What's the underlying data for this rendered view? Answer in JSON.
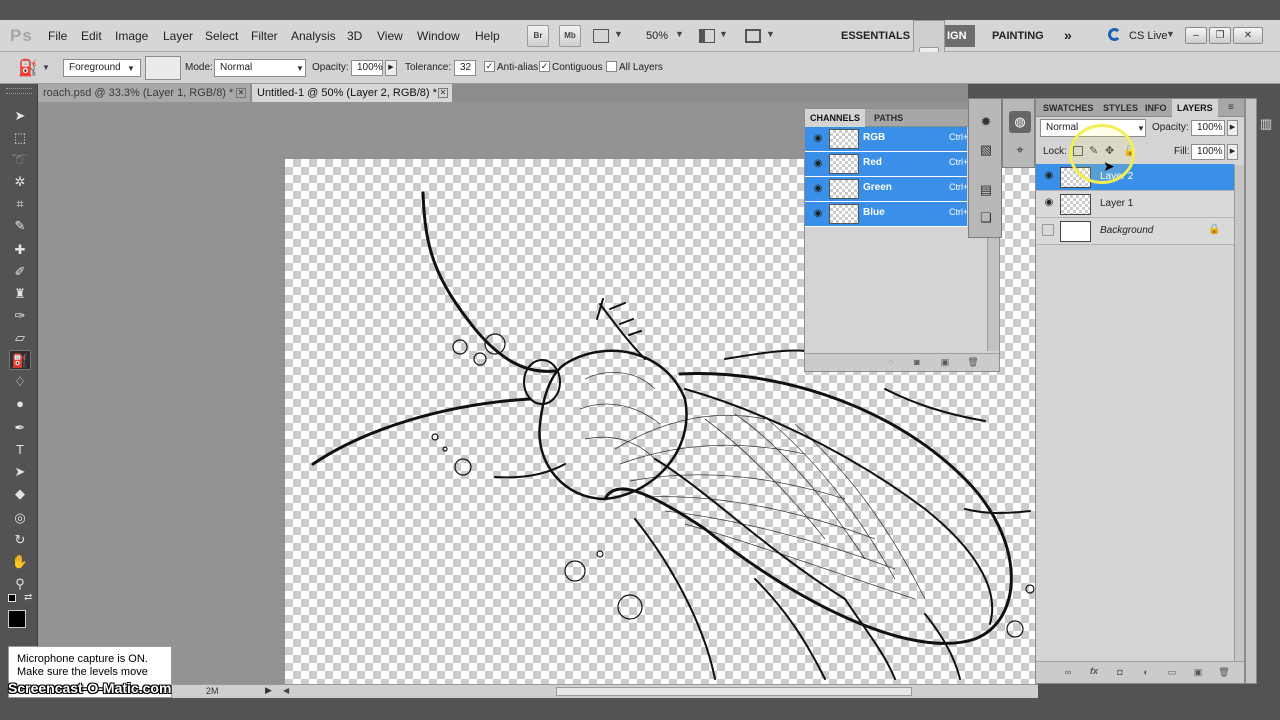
{
  "app": {
    "logo": "Ps"
  },
  "menu": [
    "File",
    "Edit",
    "Image",
    "Layer",
    "Select",
    "Filter",
    "Analysis",
    "3D",
    "View",
    "Window",
    "Help"
  ],
  "app_bar": {
    "bridge": "Br",
    "mini_bridge": "Mb",
    "zoom": "50%"
  },
  "workspaces": {
    "essentials": "ESSENTIALS",
    "design": "IGN",
    "painting": "PAINTING",
    "more": "»",
    "cslive": "CS Live"
  },
  "options": {
    "fill_source": "Foreground",
    "mode_label": "Mode:",
    "mode_value": "Normal",
    "opacity_label": "Opacity:",
    "opacity_value": "100%",
    "tolerance_label": "Tolerance:",
    "tolerance_value": "32",
    "anti_alias": "Anti-alias",
    "contiguous": "Contiguous",
    "all_layers": "All Layers"
  },
  "tabs": [
    {
      "label": "roach.psd @ 33.3% (Layer 1, RGB/8) *"
    },
    {
      "label": "Untitled-1 @ 50% (Layer 2, RGB/8) *"
    }
  ],
  "channels_panel": {
    "tabs": [
      "CHANNELS",
      "PATHS"
    ],
    "rows": [
      {
        "name": "RGB",
        "key": "Ctrl+"
      },
      {
        "name": "Red",
        "key": "Ctrl+"
      },
      {
        "name": "Green",
        "key": "Ctrl+"
      },
      {
        "name": "Blue",
        "key": "Ctrl+"
      }
    ]
  },
  "layers_panel": {
    "tabs": [
      "SWATCHES",
      "STYLES",
      "INFO",
      "LAYERS"
    ],
    "blend_mode": "Normal",
    "opacity_label": "Opacity:",
    "opacity_value": "100%",
    "lock_label": "Lock:",
    "fill_label": "Fill:",
    "fill_value": "100%",
    "layers": [
      {
        "name": "Layer 2"
      },
      {
        "name": "Layer 1"
      },
      {
        "name": "Background"
      }
    ]
  },
  "status": {
    "doc_size": "2M"
  },
  "overlay": {
    "line1": "Microphone capture is ON.",
    "line2": "Make sure the levels move"
  },
  "watermark": "Screencast-O-Matic.com"
}
